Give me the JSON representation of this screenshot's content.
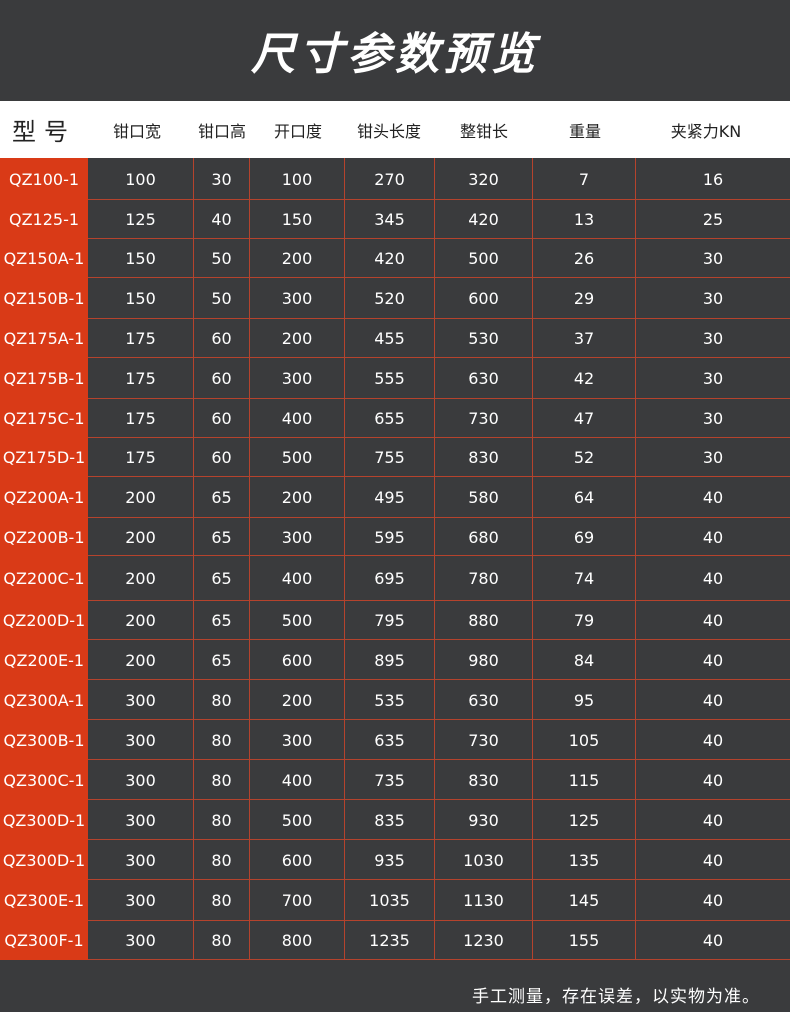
{
  "title": "尺寸参数预览",
  "headers": [
    "型号",
    "钳口宽",
    "钳口高",
    "开口度",
    "钳头长度",
    "整钳长",
    "重量",
    "夹紧力KN"
  ],
  "rows": [
    [
      "QZ100-1",
      "100",
      "30",
      "100",
      "270",
      "320",
      "7",
      "16"
    ],
    [
      "QZ125-1",
      "125",
      "40",
      "150",
      "345",
      "420",
      "13",
      "25"
    ],
    [
      "QZ150A-1",
      "150",
      "50",
      "200",
      "420",
      "500",
      "26",
      "30"
    ],
    [
      "QZ150B-1",
      "150",
      "50",
      "300",
      "520",
      "600",
      "29",
      "30"
    ],
    [
      "QZ175A-1",
      "175",
      "60",
      "200",
      "455",
      "530",
      "37",
      "30"
    ],
    [
      "QZ175B-1",
      "175",
      "60",
      "300",
      "555",
      "630",
      "42",
      "30"
    ],
    [
      "QZ175C-1",
      "175",
      "60",
      "400",
      "655",
      "730",
      "47",
      "30"
    ],
    [
      "QZ175D-1",
      "175",
      "60",
      "500",
      "755",
      "830",
      "52",
      "30"
    ],
    [
      "QZ200A-1",
      "200",
      "65",
      "200",
      "495",
      "580",
      "64",
      "40"
    ],
    [
      "QZ200B-1",
      "200",
      "65",
      "300",
      "595",
      "680",
      "69",
      "40"
    ],
    [
      "QZ200C-1",
      "200",
      "65",
      "400",
      "695",
      "780",
      "74",
      "40"
    ],
    [
      "QZ200D-1",
      "200",
      "65",
      "500",
      "795",
      "880",
      "79",
      "40"
    ],
    [
      "QZ200E-1",
      "200",
      "65",
      "600",
      "895",
      "980",
      "84",
      "40"
    ],
    [
      "QZ300A-1",
      "300",
      "80",
      "200",
      "535",
      "630",
      "95",
      "40"
    ],
    [
      "QZ300B-1",
      "300",
      "80",
      "300",
      "635",
      "730",
      "105",
      "40"
    ],
    [
      "QZ300C-1",
      "300",
      "80",
      "400",
      "735",
      "830",
      "115",
      "40"
    ],
    [
      "QZ300D-1",
      "300",
      "80",
      "500",
      "835",
      "930",
      "125",
      "40"
    ],
    [
      "QZ300D-1",
      "300",
      "80",
      "600",
      "935",
      "1030",
      "135",
      "40"
    ],
    [
      "QZ300E-1",
      "300",
      "80",
      "700",
      "1035",
      "1130",
      "145",
      "40"
    ],
    [
      "QZ300F-1",
      "300",
      "80",
      "800",
      "1235",
      "1230",
      "155",
      "40"
    ]
  ],
  "footer_note": "手工测量，存在误差，以实物为准。",
  "colors": {
    "background": "#3a3b3d",
    "model_column": "#d93a17",
    "grid_line": "#b5432d",
    "header_bg": "#ffffff"
  }
}
